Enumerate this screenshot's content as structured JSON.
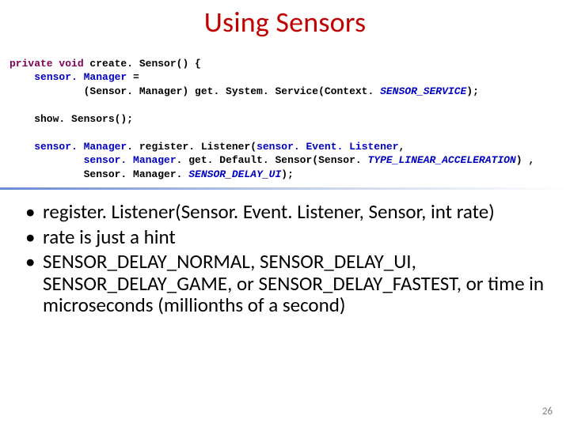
{
  "title": "Using Sensors",
  "code": {
    "l1": {
      "kw": "private void",
      "rest": " create. Sensor() {"
    },
    "l2": {
      "pre": "    ",
      "obj": "sensor. Manager",
      "rest": " ="
    },
    "l3": {
      "pre": "            (Sensor. Manager) get. System. Service(Context. ",
      "it": "SENSOR_SERVICE",
      "rest": ");"
    },
    "l4": "",
    "l5": {
      "pre": "    show. Sensors();"
    },
    "l6": "",
    "l7": {
      "pre": "    ",
      "obj1": "sensor. Manager",
      "mid": ". register. Listener(",
      "obj2": "sensor. Event. Listener",
      "rest": ","
    },
    "l8": {
      "pre": "            ",
      "obj": "sensor. Manager",
      "mid": ". get. Default. Sensor(Sensor. ",
      "it": "TYPE_LINEAR_ACCELERATION",
      "rest": ") ,"
    },
    "l9": {
      "pre": "            Sensor. Manager. ",
      "it": "SENSOR_DELAY_UI",
      "rest": ");"
    }
  },
  "bullets": [
    "register. Listener(Sensor. Event. Listener, Sensor, int rate)",
    "rate is just a hint",
    "SENSOR_DELAY_NORMAL, SENSOR_DELAY_UI, SENSOR_DELAY_GAME, or SENSOR_DELAY_FASTEST, or time in microseconds (millionths of a second)"
  ],
  "page_number": "26"
}
